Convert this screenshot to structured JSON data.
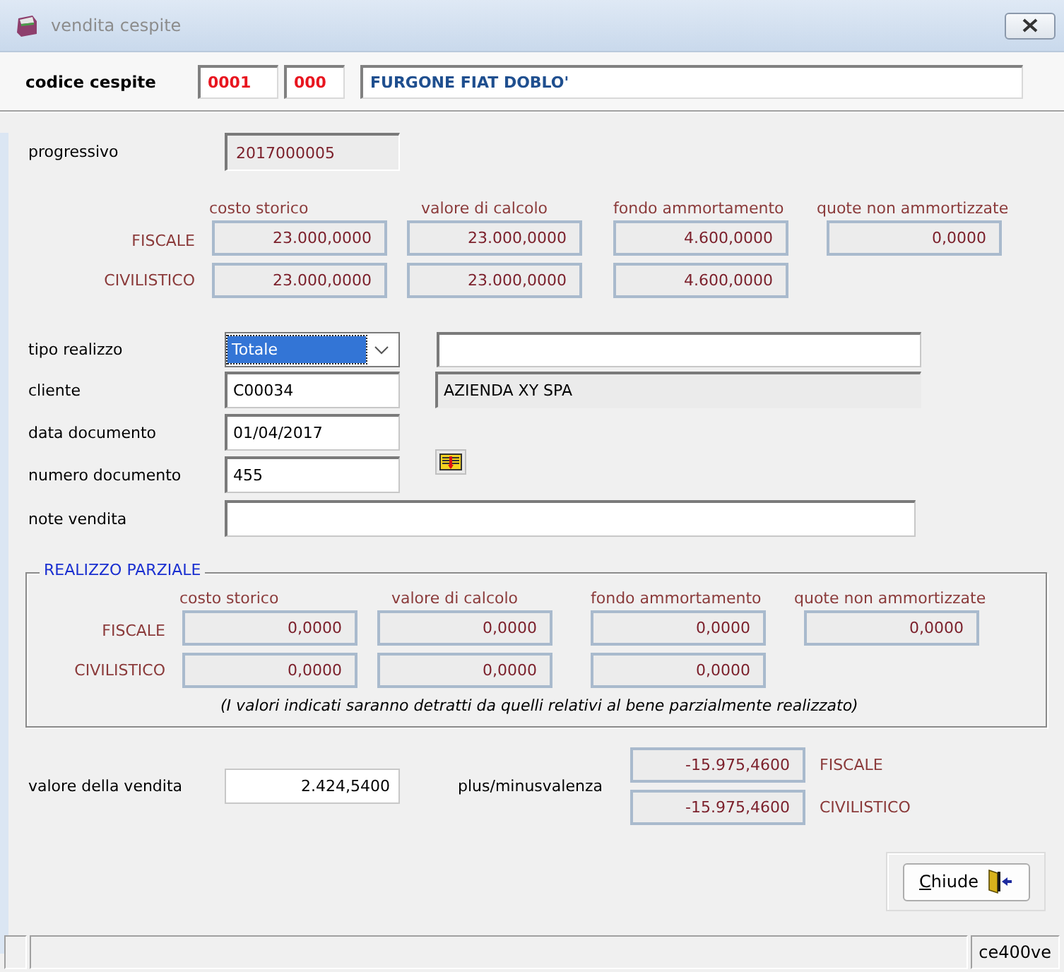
{
  "window": {
    "title": "vendita cespite"
  },
  "header": {
    "label": "codice cespite",
    "code": "0001",
    "sub_code": "000",
    "description": "FURGONE FIAT DOBLO'"
  },
  "progressivo": {
    "label": "progressivo",
    "value": "2017000005"
  },
  "values": {
    "columns": [
      "costo storico",
      "valore di calcolo",
      "fondo ammortamento",
      "quote non ammortizzate"
    ],
    "rows": [
      {
        "label": "FISCALE",
        "cells": [
          "23.000,0000",
          "23.000,0000",
          "4.600,0000",
          "0,0000"
        ]
      },
      {
        "label": "CIVILISTICO",
        "cells": [
          "23.000,0000",
          "23.000,0000",
          "4.600,0000"
        ]
      }
    ]
  },
  "fields": {
    "tipo_realizzo": {
      "label": "tipo realizzo",
      "value": "Totale",
      "focused": true
    },
    "cliente": {
      "label": "cliente",
      "code": "C00034",
      "name": "AZIENDA XY SPA"
    },
    "data_documento": {
      "label": "data documento",
      "value": "01/04/2017"
    },
    "numero_documento": {
      "label": "numero documento",
      "value": "455"
    },
    "note_vendita": {
      "label": "note vendita"
    }
  },
  "partial": {
    "title": "REALIZZO PARZIALE",
    "columns": [
      "costo storico",
      "valore di calcolo",
      "fondo ammortamento",
      "quote non ammortizzate"
    ],
    "rows": [
      {
        "label": "FISCALE",
        "cells": [
          "0,0000",
          "0,0000",
          "0,0000",
          "0,0000"
        ]
      },
      {
        "label": "CIVILISTICO",
        "cells": [
          "0,0000",
          "0,0000",
          "0,0000"
        ]
      }
    ],
    "note": "(I valori indicati saranno detratti da quelli relativi al bene parzialmente realizzato)"
  },
  "sale": {
    "label": "valore della vendita",
    "value": "2.424,5400",
    "gain_label": "plus/minusvalenza",
    "gains": [
      {
        "value": "-15.975,4600",
        "label": "FISCALE"
      },
      {
        "value": "-15.975,4600",
        "label": "CIVILISTICO"
      }
    ]
  },
  "buttons": [
    {
      "label": "Chiude"
    }
  ],
  "status_bar": {
    "program": "ce400ve"
  }
}
